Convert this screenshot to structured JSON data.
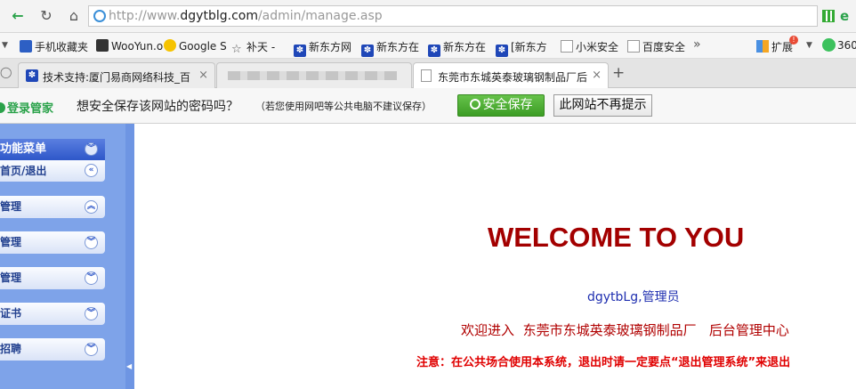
{
  "browser": {
    "url_prefix": "http://www.",
    "url_domain": "dgytblg.com",
    "url_path": "/admin/manage.asp"
  },
  "bookmarks": [
    {
      "label": "手机收藏夹",
      "icon": "phone-icon"
    },
    {
      "label": "WooYun.o",
      "icon": "wooyun-icon"
    },
    {
      "label": "Google S",
      "icon": "google-icon"
    },
    {
      "label": "补天 -",
      "icon": "star-icon"
    },
    {
      "label": "新东方网",
      "icon": "paw-icon"
    },
    {
      "label": "新东方在",
      "icon": "paw-icon"
    },
    {
      "label": "新东方在",
      "icon": "paw-icon"
    },
    {
      "label": "[新东方",
      "icon": "paw-icon"
    },
    {
      "label": "小米安全",
      "icon": "page-icon"
    },
    {
      "label": "百度安全",
      "icon": "page-icon"
    }
  ],
  "bookmarks_more": "»",
  "extensions_label": "扩展",
  "extensions_badge": "!",
  "ext_360_label": "360",
  "tabs": [
    {
      "title": "技术支持:厦门易商网络科技_百",
      "close": "×"
    },
    {
      "title": "",
      "close": ""
    },
    {
      "title": "东莞市东城英泰玻璃钢制品厂后",
      "close": "×"
    }
  ],
  "new_tab": "+",
  "password_bar": {
    "logo": "登录管家",
    "question": "想安全保存该网站的密码吗？",
    "note": "（若您使用网吧等公共电脑不建议保存）",
    "save_label": "安全保存",
    "never_label": "此网站不再提示"
  },
  "sidebar": {
    "header": "功能菜单",
    "items": [
      {
        "label": "首页/退出",
        "chevron": "«"
      },
      {
        "label": "管理",
        "chevron": "︽"
      },
      {
        "label": "管理",
        "chevron": "︾"
      },
      {
        "label": "管理",
        "chevron": "︾"
      },
      {
        "label": "证书",
        "chevron": "︾"
      },
      {
        "label": "招聘",
        "chevron": "︾"
      }
    ],
    "collapse_arrow": "◀"
  },
  "main": {
    "welcome": "WELCOME TO YOU",
    "user_name": "dgytbLg",
    "user_role": ",管理员",
    "enter_prefix": "欢迎进入",
    "company": "东莞市东城英泰玻璃钢制品厂",
    "enter_suffix": "后台管理中心",
    "notice": "注意：在公共场合使用本系统，退出时请一定要点“退出管理系统”来退出"
  },
  "colors": {
    "accent_green": "#2aa24a",
    "sidebar_blue": "#7ea3e9",
    "welcome_red": "#a30000",
    "notice_red": "#e00000"
  }
}
